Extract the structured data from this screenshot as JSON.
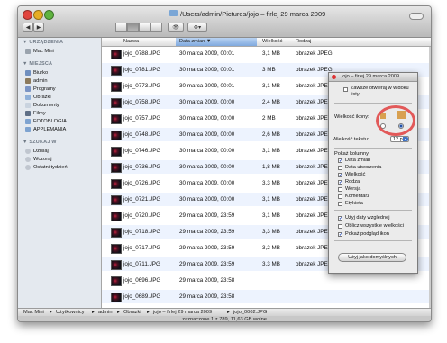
{
  "window": {
    "title": "/Users/admin/Pictures/jojo – firlej 29 marca 2009",
    "back_label": "◀",
    "forward_label": "▶",
    "eye_label": "👁",
    "action_label": "⚙▾"
  },
  "sidebar": {
    "sections": [
      {
        "heading": "▼ URZĄDZENIA",
        "items": [
          {
            "label": "Mac Mini",
            "icon": "computer-icon"
          }
        ]
      },
      {
        "heading": "▼ MIEJSCA",
        "items": [
          {
            "label": "Biurko",
            "icon": "desktop-icon"
          },
          {
            "label": "admin",
            "icon": "home-icon"
          },
          {
            "label": "Programy",
            "icon": "applications-icon"
          },
          {
            "label": "Obrazki",
            "icon": "pictures-icon"
          },
          {
            "label": "Dokumenty",
            "icon": "documents-icon"
          },
          {
            "label": "Filmy",
            "icon": "movies-icon"
          },
          {
            "label": "FOTOBLOGIA",
            "icon": "folder-icon"
          },
          {
            "label": "APPLEMANIA",
            "icon": "folder-icon"
          }
        ]
      },
      {
        "heading": "▼ SZUKAJ W",
        "items": [
          {
            "label": "Dzisiaj",
            "icon": "clock-icon"
          },
          {
            "label": "Wczoraj",
            "icon": "clock-icon"
          },
          {
            "label": "Ostatni tydzień",
            "icon": "clock-icon"
          }
        ]
      }
    ]
  },
  "columns": {
    "name": "Nazwa",
    "date": "Data zmian ▼",
    "size": "Wielkość",
    "kind": "Rodzaj"
  },
  "rows": [
    {
      "name": "jojo_0788.JPG",
      "date": "30 marca 2009, 00:01",
      "size": "3,1 MB",
      "kind": "obrazek JPEG"
    },
    {
      "name": "jojo_0781.JPG",
      "date": "30 marca 2009, 00:01",
      "size": "3 MB",
      "kind": "obrazek JPEG"
    },
    {
      "name": "jojo_0773.JPG",
      "date": "30 marca 2009, 00:01",
      "size": "3,1 MB",
      "kind": "obrazek JPEG"
    },
    {
      "name": "jojo_0758.JPG",
      "date": "30 marca 2009, 00:00",
      "size": "2,4 MB",
      "kind": "obrazek JPEG"
    },
    {
      "name": "jojo_0757.JPG",
      "date": "30 marca 2009, 00:00",
      "size": "2 MB",
      "kind": "obrazek JPEG"
    },
    {
      "name": "jojo_0748.JPG",
      "date": "30 marca 2009, 00:00",
      "size": "2,6 MB",
      "kind": "obrazek JPEG"
    },
    {
      "name": "jojo_0746.JPG",
      "date": "30 marca 2009, 00:00",
      "size": "3,1 MB",
      "kind": "obrazek JPEG"
    },
    {
      "name": "jojo_0736.JPG",
      "date": "30 marca 2009, 00:00",
      "size": "1,8 MB",
      "kind": "obrazek JPEG"
    },
    {
      "name": "jojo_0726.JPG",
      "date": "30 marca 2009, 00:00",
      "size": "3,3 MB",
      "kind": "obrazek JPEG"
    },
    {
      "name": "jojo_0721.JPG",
      "date": "30 marca 2009, 00:00",
      "size": "3,1 MB",
      "kind": "obrazek JPEG"
    },
    {
      "name": "jojo_0720.JPG",
      "date": "29 marca 2009, 23:59",
      "size": "3,1 MB",
      "kind": "obrazek JPEG"
    },
    {
      "name": "jojo_0718.JPG",
      "date": "29 marca 2009, 23:59",
      "size": "3,3 MB",
      "kind": "obrazek JPEG"
    },
    {
      "name": "jojo_0717.JPG",
      "date": "29 marca 2009, 23:59",
      "size": "3,2 MB",
      "kind": "obrazek JPEG"
    },
    {
      "name": "jojo_0711.JPG",
      "date": "29 marca 2009, 23:59",
      "size": "3,3 MB",
      "kind": "obrazek JPEG"
    },
    {
      "name": "jojo_0696.JPG",
      "date": "29 marca 2009, 23:58",
      "size": "",
      "kind": ""
    },
    {
      "name": "jojo_0689.JPG",
      "date": "29 marca 2009, 23:58",
      "size": "",
      "kind": ""
    }
  ],
  "pathbar": {
    "items": [
      "Mac Mini",
      "Użytkownicy",
      "admin",
      "Obrazki",
      "jojo – firlej 29 marca 2009",
      "jojo_0002.JPG"
    ],
    "separator": "▸"
  },
  "status": "zaznaczone 1 z 789, 11,63 GB wolne",
  "view_options": {
    "title": "jojo – firlej 29 marca 2009",
    "always_open": "Zawsze otwieraj w widoku listy.",
    "icon_size_label": "Wielkość ikony:",
    "text_size_label": "Wielkość tekstu:",
    "text_size_value": "12 pkt",
    "show_columns_label": "Pokaż kolumny:",
    "columns": [
      {
        "label": "Data zmian",
        "checked": true
      },
      {
        "label": "Data utworzenia",
        "checked": false
      },
      {
        "label": "Wielkość",
        "checked": true
      },
      {
        "label": "Rodzaj",
        "checked": true
      },
      {
        "label": "Wersja",
        "checked": false
      },
      {
        "label": "Komentarz",
        "checked": false
      },
      {
        "label": "Etykieta",
        "checked": false
      }
    ],
    "options": [
      {
        "label": "Użyj daty względnej",
        "checked": true
      },
      {
        "label": "Oblicz wszystkie wielkości",
        "checked": false
      },
      {
        "label": "Pokaż podgląd ikon",
        "checked": true
      }
    ],
    "default_button": "Użyj jako domyślnych"
  }
}
